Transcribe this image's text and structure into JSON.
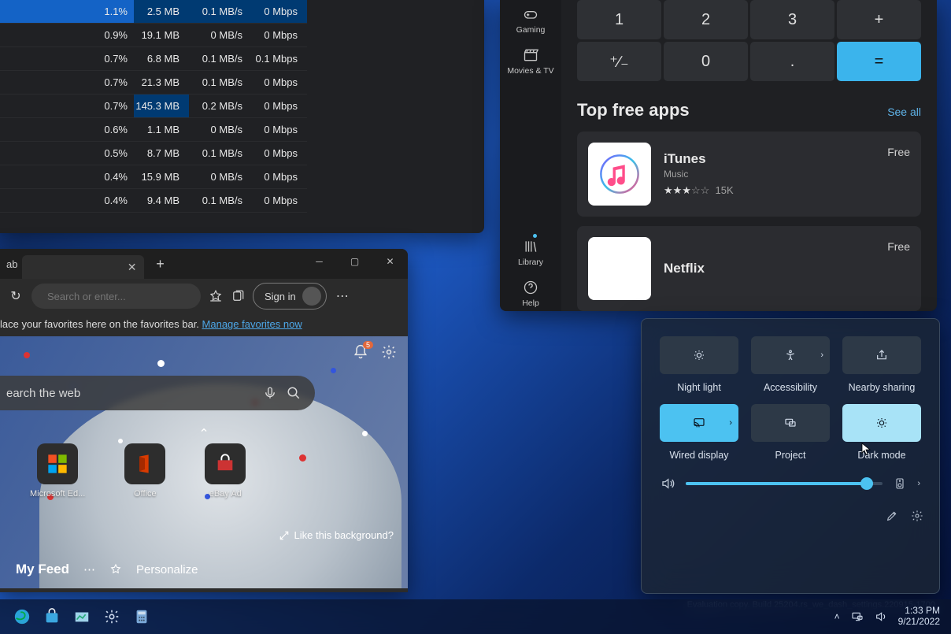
{
  "taskmgr": {
    "rows": [
      {
        "cpu": "1.1%",
        "mem": "2.5 MB",
        "disk": "0.1 MB/s",
        "net": "0 Mbps",
        "sel": "top"
      },
      {
        "cpu": "0.9%",
        "mem": "19.1 MB",
        "disk": "0 MB/s",
        "net": "0 Mbps"
      },
      {
        "cpu": "0.7%",
        "mem": "6.8 MB",
        "disk": "0.1 MB/s",
        "net": "0.1 Mbps"
      },
      {
        "cpu": "0.7%",
        "mem": "21.3 MB",
        "disk": "0.1 MB/s",
        "net": "0 Mbps"
      },
      {
        "cpu": "0.7%",
        "mem": "145.3 MB",
        "disk": "0.2 MB/s",
        "net": "0 Mbps",
        "sel": "mem"
      },
      {
        "cpu": "0.6%",
        "mem": "1.1 MB",
        "disk": "0 MB/s",
        "net": "0 Mbps"
      },
      {
        "cpu": "0.5%",
        "mem": "8.7 MB",
        "disk": "0.1 MB/s",
        "net": "0 Mbps"
      },
      {
        "cpu": "0.4%",
        "mem": "15.9 MB",
        "disk": "0 MB/s",
        "net": "0 Mbps"
      },
      {
        "cpu": "0.4%",
        "mem": "9.4 MB",
        "disk": "0.1 MB/s",
        "net": "0 Mbps"
      }
    ]
  },
  "store": {
    "side": {
      "gaming": "Gaming",
      "movies": "Movies & TV",
      "library": "Library",
      "help": "Help"
    },
    "calc": {
      "keys": [
        "1",
        "2",
        "3",
        "+",
        "+/-",
        "0",
        ".",
        "="
      ],
      "plusminus": "⁺∕₋"
    },
    "header": "Top free apps",
    "see_all": "See all",
    "apps": [
      {
        "name": "iTunes",
        "cat": "Music",
        "stars_full": 3,
        "stars_empty": 2,
        "count": "15K",
        "price": "Free"
      },
      {
        "name": "Netflix",
        "cat": "",
        "price": "Free"
      }
    ]
  },
  "edge": {
    "tab_label": "ab",
    "refresh": "↻",
    "search_placeholder": "Search or enter...",
    "sign_in": "Sign in",
    "favbar_prefix": "lace your favorites here on the favorites bar.  ",
    "favbar_link": "Manage favorites now",
    "searchweb": "earch the web",
    "tiles": [
      {
        "label": "Microsoft Ed...",
        "color": "ms"
      },
      {
        "label": "Office",
        "color": "office"
      },
      {
        "label": "eBay Ad",
        "color": "ebay"
      }
    ],
    "notif_badge": "5",
    "like_bg": "Like this background?",
    "feed": "My Feed",
    "personalize": "Personalize"
  },
  "qs": {
    "tiles": [
      {
        "label": "Night light",
        "on": false,
        "chev": false,
        "icon": "brightness"
      },
      {
        "label": "Accessibility",
        "on": false,
        "chev": true,
        "icon": "accessibility"
      },
      {
        "label": "Nearby sharing",
        "on": false,
        "chev": false,
        "icon": "share"
      },
      {
        "label": "Wired display",
        "on": true,
        "chev": true,
        "icon": "cast"
      },
      {
        "label": "Project",
        "on": false,
        "chev": false,
        "icon": "project"
      },
      {
        "label": "Dark mode",
        "on": true,
        "style": "on2",
        "chev": false,
        "icon": "brightness"
      }
    ],
    "volume_pct": 92
  },
  "watermark": "Evaluation copy. Build 25204.rs_we_dash_settings.220915-1700",
  "taskbar": {
    "time": "1:33 PM",
    "date": "9/21/2022"
  }
}
